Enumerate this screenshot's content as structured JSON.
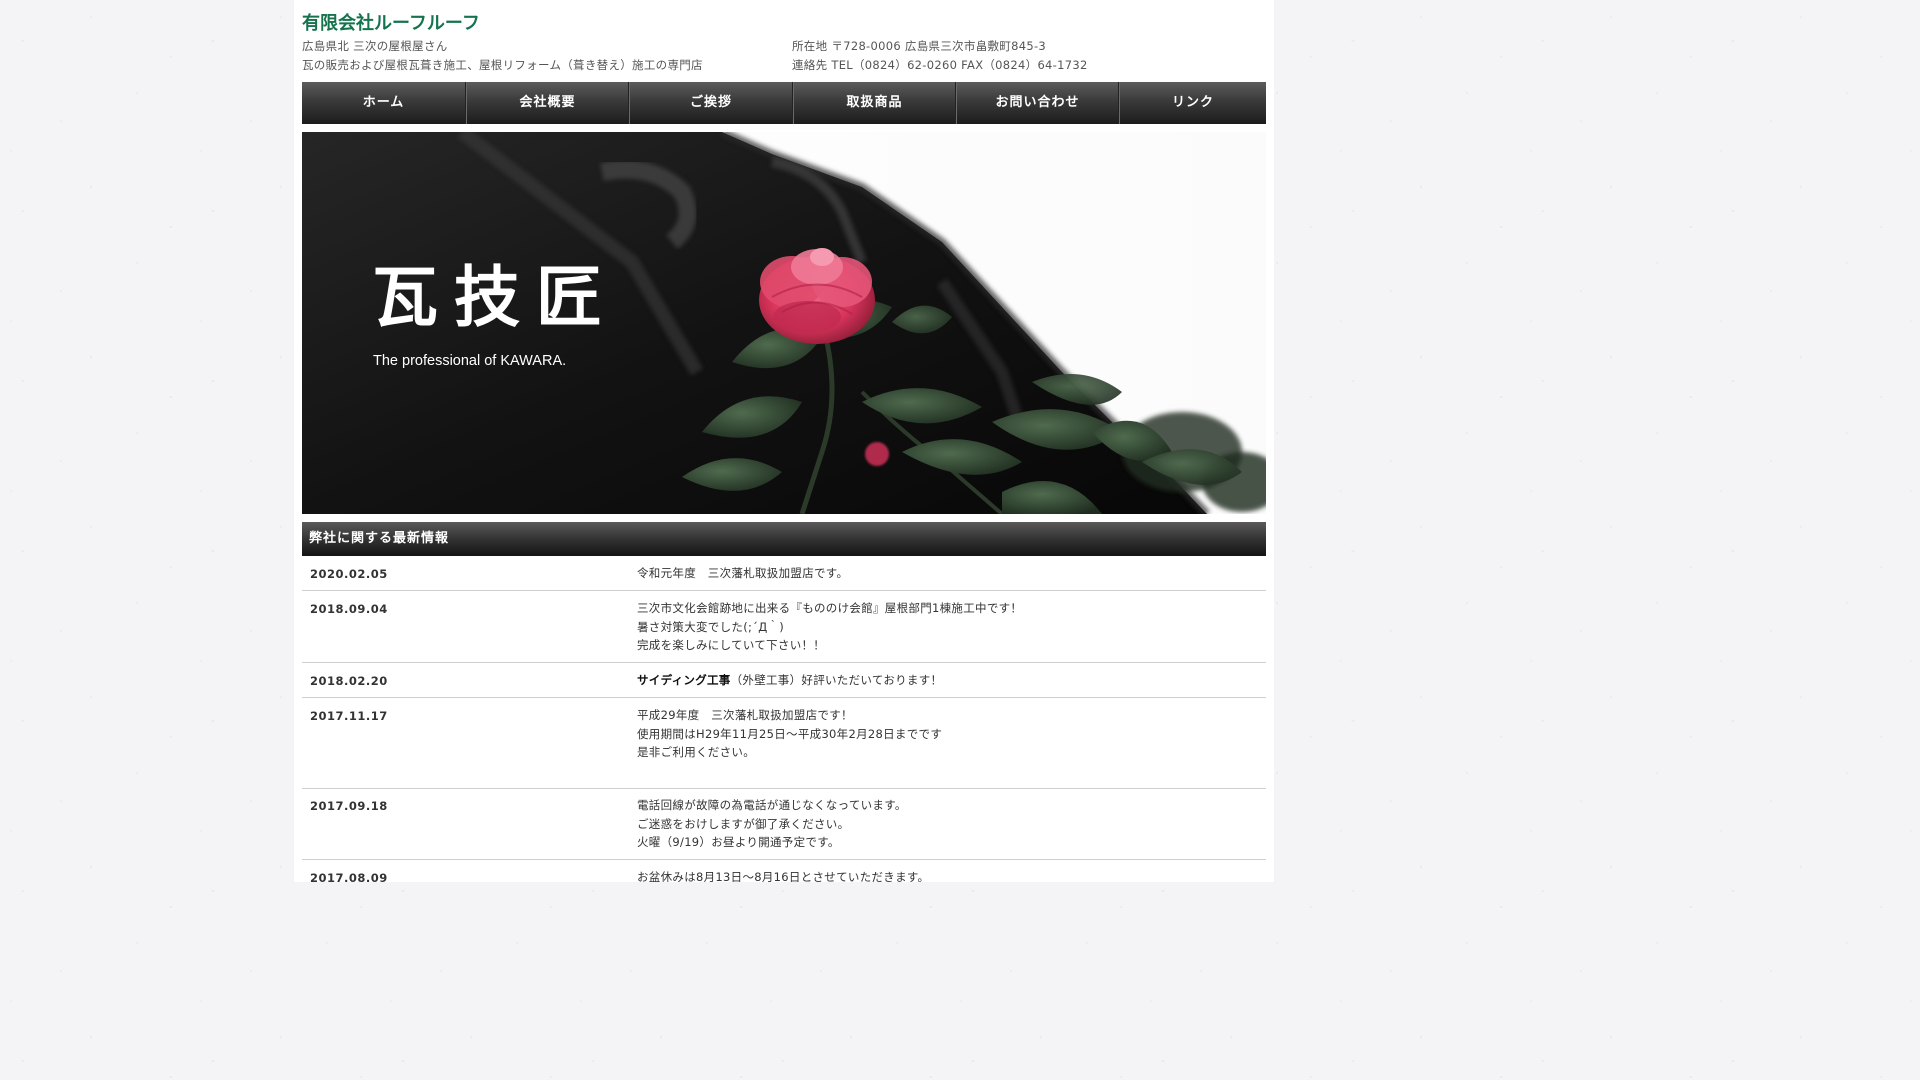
{
  "header": {
    "title": "有限会社ルーフルーフ",
    "tagline_1": "広島県北 三次の屋根屋さん",
    "tagline_2": "瓦の販売および屋根瓦葺き施工、屋根リフォーム（葺き替え）施工の専門店",
    "address_label": "所在地",
    "address": "〒728-0006 広島県三次市畠敷町845-3",
    "contact_label": "連絡先",
    "contact": "TEL（0824）62-0260 FAX（0824）64-1732"
  },
  "nav": {
    "items": [
      "ホーム",
      "会社概要",
      "ご挨拶",
      "取扱商品",
      "お問い合わせ",
      "リンク"
    ]
  },
  "hero": {
    "title": "瓦技匠",
    "subtitle": "The professional of KAWARA."
  },
  "news": {
    "heading": "弊社に関する最新情報",
    "items": [
      {
        "date": "2020.02.05",
        "lines": [
          "令和元年度　三次藩札取扱加盟店です。"
        ]
      },
      {
        "date": "2018.09.04",
        "lines": [
          "三次市文化会館跡地に出来る『もののけ会館』屋根部門1棟施工中です！",
          "暑さ対策大変でした(;´Д｀)",
          "完成を楽しみにしていて下さい！！"
        ]
      },
      {
        "date": "2018.02.20",
        "bold": "サイディング工事",
        "rest": "（外壁工事）好評いただいております！"
      },
      {
        "date": "2017.11.17",
        "lines": [
          "平成29年度　三次藩札取扱加盟店です！",
          "使用期間はH29年11月25日～平成30年2月28日までです",
          "是非ご利用ください。"
        ]
      },
      {
        "date": "2017.09.18",
        "lines": [
          "電話回線が故障の為電話が通じなくなっています。",
          "ご迷惑をおけしますが御了承ください。",
          "火曜（9/19）お昼より開通予定です。"
        ]
      },
      {
        "date": "2017.08.09",
        "lines": [
          "お盆休みは8月13日～8月16日とさせていただきます。"
        ]
      }
    ]
  },
  "colors": {
    "brand_green": "#16734e",
    "nav_dark": "#2a2a2a",
    "camellia": "#d8345a"
  }
}
